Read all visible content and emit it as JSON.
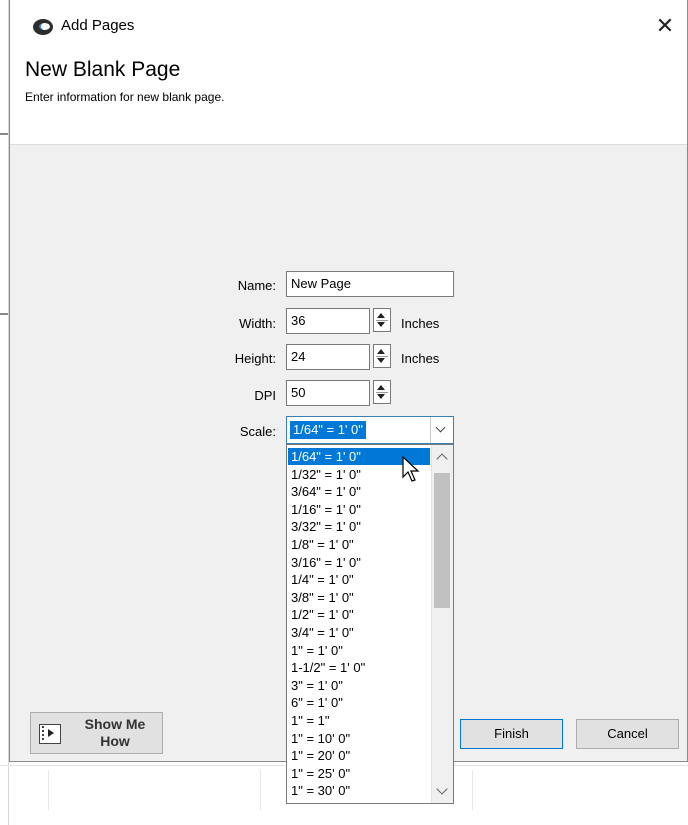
{
  "dialog": {
    "title": "Add Pages",
    "close_glyph": "✕",
    "heading": "New Blank Page",
    "subheading": "Enter information for new blank page."
  },
  "form": {
    "name_label": "Name:",
    "name_value": "New Page",
    "width_label": "Width:",
    "width_value": "36",
    "width_unit": "Inches",
    "height_label": "Height:",
    "height_value": "24",
    "height_unit": "Inches",
    "dpi_label": "DPI",
    "dpi_value": "50",
    "scale_label": "Scale:",
    "scale_value": "1/64\" = 1' 0\""
  },
  "scale_options": [
    "1/64\" = 1' 0\"",
    "1/32\" = 1' 0\"",
    "3/64\" = 1' 0\"",
    "1/16\" = 1' 0\"",
    "3/32\" = 1' 0\"",
    "1/8\" = 1' 0\"",
    "3/16\" = 1' 0\"",
    "1/4\" = 1' 0\"",
    "3/8\" = 1' 0\"",
    "1/2\" = 1' 0\"",
    "3/4\" = 1' 0\"",
    "1\" = 1' 0\"",
    "1-1/2\" = 1' 0\"",
    "3\" = 1' 0\"",
    "6\" = 1' 0\"",
    "1\" = 1\"",
    "1\" = 10' 0\"",
    "1\" = 20' 0\"",
    "1\" = 25' 0\"",
    "1\" = 30' 0\""
  ],
  "buttons": {
    "show_me_how": "Show Me How",
    "finish": "Finish",
    "cancel": "Cancel"
  },
  "icons": {
    "app": "app-eye-icon",
    "close": "close-icon",
    "show_me_how": "film-play-icon",
    "spinner": "spin-arrows-icon",
    "dropdown": "chevron-down-icon"
  },
  "colors": {
    "selection": "#0078d7",
    "dialog_bg": "#f0f0f0"
  }
}
